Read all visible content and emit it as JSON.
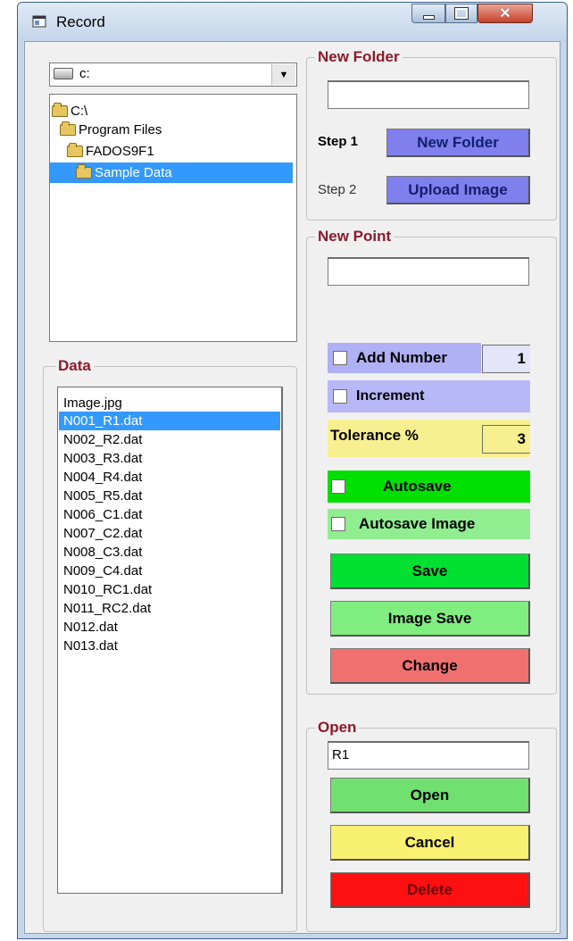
{
  "window": {
    "title": "Record"
  },
  "drive": {
    "value": "c:"
  },
  "directories": [
    {
      "label": "C:\\"
    },
    {
      "label": "Program Files"
    },
    {
      "label": "FADOS9F1"
    },
    {
      "label": "Sample Data"
    }
  ],
  "data_group": {
    "title": "Data",
    "files": [
      "Image.jpg",
      "N001_R1.dat",
      "N002_R2.dat",
      "N003_R3.dat",
      "N004_R4.dat",
      "N005_R5.dat",
      "N006_C1.dat",
      "N007_C2.dat",
      "N008_C3.dat",
      "N009_C4.dat",
      "N010_RC1.dat",
      "N011_RC2.dat",
      "N012.dat",
      "N013.dat"
    ]
  },
  "new_folder": {
    "title": "New Folder",
    "input_value": "",
    "step1_label": "Step 1",
    "step1_button": "New Folder",
    "step2_label": "Step 2",
    "step2_button": "Upload Image"
  },
  "new_point": {
    "title": "New Point",
    "input_value": "",
    "add_number_label": "Add Number",
    "add_number_value": "1",
    "increment_label": "Increment",
    "tolerance_label": "Tolerance %",
    "tolerance_value": "3",
    "autosave_label": "Autosave",
    "autosave_image_label": "Autosave Image",
    "save_button": "Save",
    "image_save_button": "Image Save",
    "change_button": "Change"
  },
  "open_group": {
    "title": "Open",
    "input_value": "R1",
    "open_button": "Open",
    "cancel_button": "Cancel",
    "delete_button": "Delete"
  },
  "colors": {
    "step_button": "#7f7fee",
    "autosave": "#00e000",
    "autosave_image": "#90ee90",
    "save": "#00e030",
    "image_save": "#80ee80",
    "change": "#f07070",
    "open": "#70e070",
    "cancel": "#f8f070",
    "delete": "#ff1010",
    "tolerance_bg": "#f8f090",
    "add_number_bg": "#b0b0f4",
    "increment_bg": "#b8b8f8"
  }
}
